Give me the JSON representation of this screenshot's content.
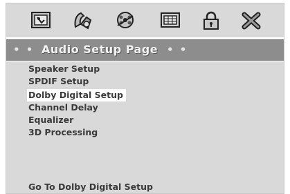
{
  "header": {
    "dots_left": "• •",
    "title": "Audio Setup Page",
    "dots_right": "• •"
  },
  "toolbar": {
    "icons": [
      "general-setup-icon",
      "audio-setup-icon",
      "video-setup-icon",
      "preference-icon",
      "password-lock-icon",
      "exit-icon"
    ]
  },
  "menu": {
    "items": [
      {
        "label": "Speaker Setup"
      },
      {
        "label": "SPDIF Setup"
      },
      {
        "label": "Dolby Digital Setup",
        "selected": true
      },
      {
        "label": "Channel Delay"
      },
      {
        "label": "Equalizer"
      },
      {
        "label": "3D Processing"
      }
    ]
  },
  "status": {
    "text": "Go To Dolby Digital Setup"
  }
}
